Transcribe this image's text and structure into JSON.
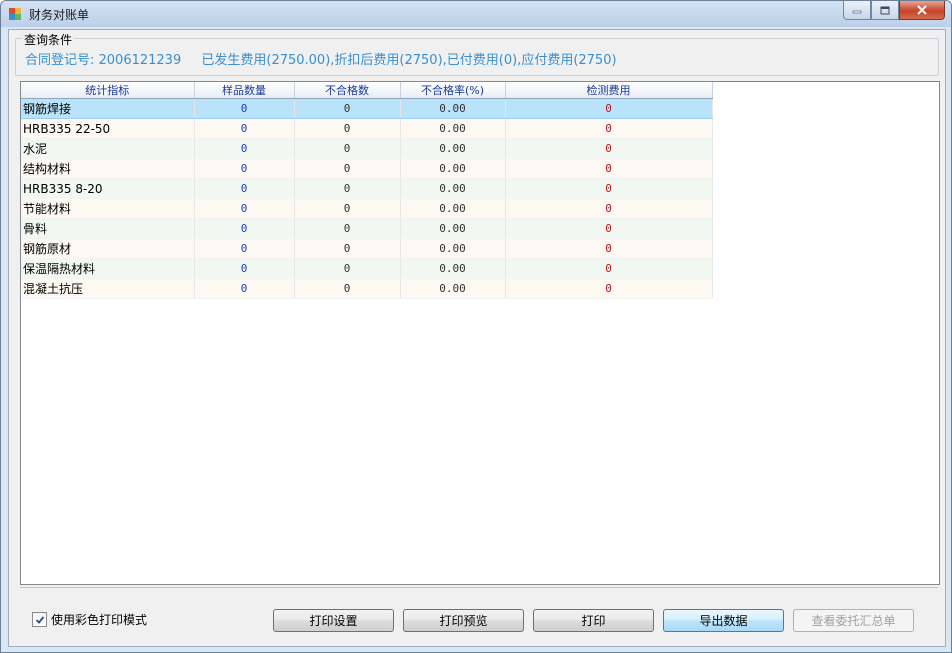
{
  "window": {
    "title": "财务对账单"
  },
  "query_group": {
    "legend": "查询条件",
    "registration": "合同登记号: 2006121239",
    "fees": "已发生费用(2750.00),折扣后费用(2750),已付费用(0),应付费用(2750)"
  },
  "table": {
    "headers": [
      "统计指标",
      "样品数量",
      "不合格数",
      "不合格率(%)",
      "检测费用"
    ],
    "rows": [
      [
        "钢筋焊接",
        "0",
        "0",
        "0.00",
        "0"
      ],
      [
        "HRB335  22-50",
        "0",
        "0",
        "0.00",
        "0"
      ],
      [
        "水泥",
        "0",
        "0",
        "0.00",
        "0"
      ],
      [
        "结构材料",
        "0",
        "0",
        "0.00",
        "0"
      ],
      [
        "HRB335  8-20",
        "0",
        "0",
        "0.00",
        "0"
      ],
      [
        "节能材料",
        "0",
        "0",
        "0.00",
        "0"
      ],
      [
        "骨料",
        "0",
        "0",
        "0.00",
        "0"
      ],
      [
        "钢筋原材",
        "0",
        "0",
        "0.00",
        "0"
      ],
      [
        "保温隔热材料",
        "0",
        "0",
        "0.00",
        "0"
      ],
      [
        "混凝土抗压",
        "0",
        "0",
        "0.00",
        "0"
      ]
    ]
  },
  "footer": {
    "color_print_label": "使用彩色打印模式",
    "color_print_checked": true,
    "buttons": {
      "print_setup": "打印设置",
      "print_preview": "打印预览",
      "print": "打印",
      "export": "导出数据",
      "view_summary": "查看委托汇总单"
    }
  },
  "colors": {
    "accent_text": "#3a8fd1",
    "selected_row": "#b9e3fb",
    "fee_red": "#c0141c"
  },
  "icons": [
    "app-icon",
    "minimize-icon",
    "maximize-icon",
    "close-icon",
    "checkmark-icon"
  ]
}
